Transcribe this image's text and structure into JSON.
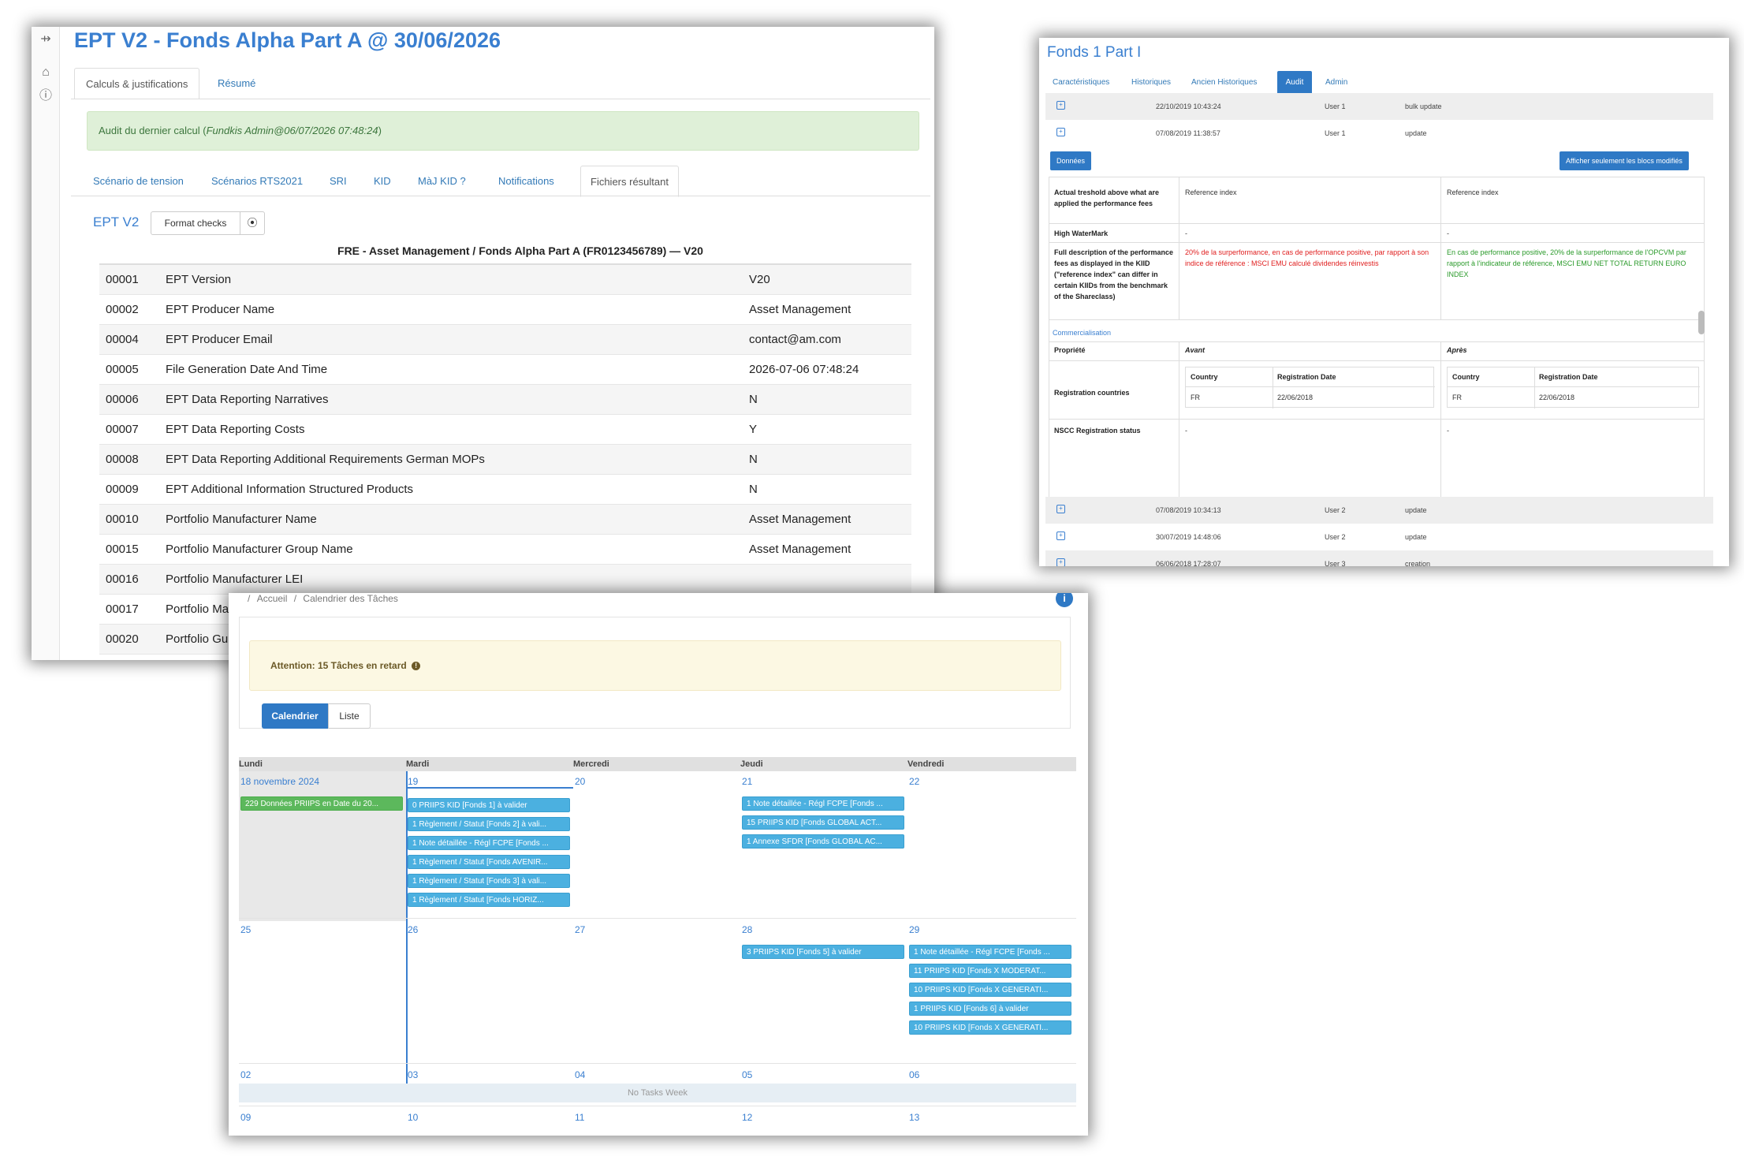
{
  "w1": {
    "sidebar_icons": [
      "collapse-icon",
      "home-icon",
      "help-icon"
    ],
    "title": "EPT V2 - Fonds Alpha Part A @ 30/06/2026",
    "tabs": [
      "Calculs & justifications",
      "Résumé"
    ],
    "audit_prefix": "Audit du dernier calcul (",
    "audit_user": "Fundkis Admin@06/07/2026 07:48:24",
    "audit_suffix": ")",
    "subtabs": [
      "Scénario de tension",
      "Scénarios RTS2021",
      "SRI",
      "KID",
      "MàJ KID ?",
      "Notifications",
      "Fichiers résultant"
    ],
    "ept_label": "EPT V2",
    "format_checks": "Format checks",
    "download_glyph": "⦿",
    "heading": "FRE - Asset Management / Fonds Alpha Part A (FR0123456789) — V20",
    "rows": [
      [
        "00001",
        "EPT Version",
        "V20"
      ],
      [
        "00002",
        "EPT Producer Name",
        "Asset Management"
      ],
      [
        "00004",
        "EPT Producer Email",
        "contact@am.com"
      ],
      [
        "00005",
        "File Generation Date And Time",
        "2026-07-06 07:48:24"
      ],
      [
        "00006",
        "EPT Data Reporting Narratives",
        "N"
      ],
      [
        "00007",
        "EPT Data Reporting Costs",
        "Y"
      ],
      [
        "00008",
        "EPT Data Reporting Additional Requirements German MOPs",
        "N"
      ],
      [
        "00009",
        "EPT Additional Information Structured Products",
        "N"
      ],
      [
        "00010",
        "Portfolio Manufacturer Name",
        "Asset Management"
      ],
      [
        "00015",
        "Portfolio Manufacturer Group Name",
        "Asset Management"
      ],
      [
        "00016",
        "Portfolio Manufacturer LEI",
        ""
      ],
      [
        "00017",
        "Portfolio Ma",
        ""
      ],
      [
        "00020",
        "Portfolio Gu",
        ""
      ]
    ]
  },
  "w2": {
    "title": "Fonds 1 Part I",
    "tabs": [
      "Caractéristiques",
      "Historiques",
      "Ancien Historiques",
      "Audit",
      "Admin"
    ],
    "audit_rows_top": [
      [
        "22/10/2019 10:43:24",
        "User 1",
        "bulk update"
      ],
      [
        "07/08/2019 11:38:57",
        "User 1",
        "update"
      ]
    ],
    "btn_donnees": "Données",
    "btn_afficher": "Afficher seulement les blocs modifiés",
    "perf": {
      "r1_label": "Actual treshold above what are applied the performance fees",
      "r1_before": "Reference index",
      "r1_after": "Reference index",
      "r2_label": "High WaterMark",
      "r2_before": "-",
      "r2_after": "-",
      "r3_label": "Full description of the performance fees as displayed in the KIID (\"reference index\" can differ in certain KIIDs from the benchmark of the Shareclass)",
      "r3_before": "20% de la surperformance, en cas de performance positive, par rapport à son indice de référence : MSCI EMU calculé dividendes réinvestis",
      "r3_after": "En cas de performance positive, 20% de la surperformance de l'OPCVM par rapport à l'indicateur de référence, MSCI EMU NET TOTAL RETURN EURO INDEX"
    },
    "commercialisation": {
      "section": "Commercialisation",
      "col_prop": "Propriété",
      "col_avant": "Avant",
      "col_apres": "Après",
      "reg_label": "Registration countries",
      "sub_country": "Country",
      "sub_date": "Registration Date",
      "before_country": "FR",
      "before_date": "22/06/2018",
      "after_country": "FR",
      "after_date": "22/06/2018",
      "nscc_label": "NSCC Registration status",
      "nscc_before": "-",
      "nscc_after": "-"
    },
    "audit_rows_bottom": [
      [
        "07/08/2019 10:34:13",
        "User 2",
        "update"
      ],
      [
        "30/07/2019 14:48:06",
        "User 2",
        "update"
      ],
      [
        "06/06/2018 17:28:07",
        "User 3",
        "creation"
      ]
    ]
  },
  "w3": {
    "crumb_sep": "/",
    "crumb_home": "Accueil",
    "crumb_current": "Calendrier des Tâches",
    "warning": "Attention: 15 Tâches en retard",
    "btn_calendar": "Calendrier",
    "btn_list": "Liste",
    "days": [
      "Lundi",
      "Mardi",
      "Mercredi",
      "Jeudi",
      "Vendredi"
    ],
    "week1": [
      "18 novembre 2024",
      "19",
      "20",
      "21",
      "22"
    ],
    "week2": [
      "25",
      "26",
      "27",
      "28",
      "29"
    ],
    "week3": [
      "02",
      "03",
      "04",
      "05",
      "06"
    ],
    "week4": [
      "09",
      "10",
      "11",
      "12",
      "13"
    ],
    "no_tasks": "No Tasks Week",
    "events": {
      "mon18": [
        "229 Données PRIIPS en Date du 20..."
      ],
      "tue19": [
        "0 PRIIPS KID [Fonds 1] à valider",
        "1 Règlement / Statut [Fonds 2] à vali...",
        "1 Note détaillée - Régl FCPE [Fonds ...",
        "1 Règlement / Statut [Fonds AVENIR...",
        "1 Règlement / Statut [Fonds 3] à vali...",
        "1 Règlement / Statut [Fonds HORIZ..."
      ],
      "thu21": [
        "1 Note détaillée - Régl FCPE [Fonds ...",
        "15 PRIIPS KID [Fonds GLOBAL ACT...",
        "1 Annexe SFDR [Fonds GLOBAL AC..."
      ],
      "thu28": [
        "3 PRIIPS KID [Fonds 5] à valider"
      ],
      "fri29": [
        "1 Note détaillée - Régl FCPE [Fonds ...",
        "11 PRIIPS KID [Fonds X MODERAT...",
        "10 PRIIPS KID [Fonds X GENERATI...",
        "1 PRIIPS KID [Fonds 6] à valider",
        "10 PRIIPS KID [Fonds X GENERATI..."
      ]
    }
  }
}
